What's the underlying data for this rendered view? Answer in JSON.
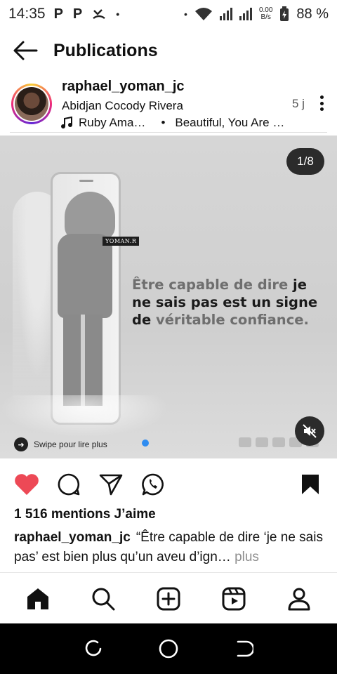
{
  "status_bar": {
    "time": "14:35",
    "left_icons": [
      "P",
      "P"
    ],
    "net_speed_value": "0.00",
    "net_speed_unit": "B/s",
    "battery": "88 %"
  },
  "header": {
    "title": "Publications"
  },
  "post": {
    "username": "raphael_yoman_jc",
    "location": "Abidjan Cocody Rivera",
    "music_artist": "Ruby Ama…",
    "music_title": "Beautiful, You Are …",
    "time_ago": "5 j",
    "media": {
      "counter": "1/8",
      "tag_text": "YOMAN.R",
      "quote_line1_a": "Être capable de dire",
      "quote_line1_b": " je",
      "quote_line2": "ne sais pas est un signe",
      "quote_line3_a": "de ",
      "quote_line3_b": "véritable confiance.",
      "swipe_text": "Swipe pour lire plus"
    },
    "likes": "1 516 mentions J’aime",
    "caption_user": "raphael_yoman_jc",
    "caption_text": "“Être capable de dire ‘je ne sais pas’ est bien plus qu’un aveu d’ign…",
    "caption_more": "plus"
  },
  "colors": {
    "like": "#ed4956",
    "accent_dot": "#2f8cf0"
  },
  "icons": {
    "back": "arrow-left-icon",
    "like": "heart-icon",
    "comment": "comment-icon",
    "share": "send-icon",
    "whatsapp": "whatsapp-icon",
    "save": "bookmark-icon",
    "home": "home-icon",
    "search": "search-icon",
    "create": "plus-square-icon",
    "reels": "reels-icon",
    "profile": "profile-icon"
  }
}
